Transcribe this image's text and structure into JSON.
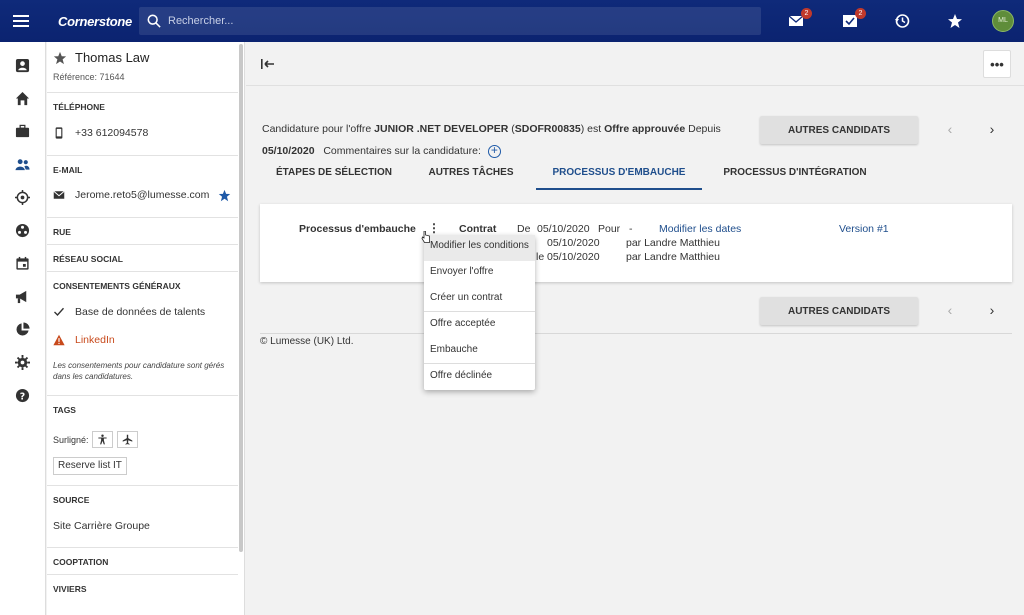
{
  "topbar": {
    "logo": "Cornerstone",
    "search_placeholder": "Rechercher...",
    "mail_badge": "2",
    "tasks_badge": "2",
    "avatar_initials": "ML"
  },
  "candidate": {
    "name": "Thomas Law",
    "reference": "Référence: 71644",
    "phone_title": "TÉLÉPHONE",
    "phone": "+33 612094578",
    "email_title": "E-MAIL",
    "email": "Jerome.reto5@lumesse.com",
    "street_title": "RUE",
    "social_title": "RÉSEAU SOCIAL",
    "consents_title": "CONSENTEMENTS GÉNÉRAUX",
    "consent_talent_db": "Base de données de talents",
    "consent_linkedin": "LinkedIn",
    "consents_note": "Les consentements pour candidature sont gérés dans les candidatures.",
    "tags_title": "TAGS",
    "highlight_label": "Surligné:",
    "tag_reserve": "Reserve list IT",
    "source_title": "SOURCE",
    "source_value": "Site Carrière Groupe",
    "cooptation_title": "COOPTATION",
    "viviers_title": "VIVIERS"
  },
  "application": {
    "prefix": "Candidature pour l'offre",
    "offer_title": "JUNIOR .NET DEVELOPER",
    "offer_ref": "SDOFR00835",
    "middle": "est",
    "status": "Offre approuvée",
    "since": "Depuis",
    "date": "05/10/2020",
    "comments_label": "Commentaires sur la candidature:"
  },
  "buttons": {
    "other_candidates": "AUTRES CANDIDATS",
    "more": "•••",
    "prev": "‹",
    "next": "›"
  },
  "tabs": [
    "ÉTAPES DE SÉLECTION",
    "AUTRES TÂCHES",
    "PROCESSUS D'EMBAUCHE",
    "PROCESSUS D'INTÉGRATION"
  ],
  "hiring": {
    "label": "Processus d'embauche",
    "contract": "Contrat",
    "from": "De",
    "from_date": "05/10/2020",
    "for": "Pour",
    "dash": "-",
    "modify_dates": "Modifier les dates",
    "version": "Version #1",
    "row2_date": "05/10/2020",
    "row2_by": "par Landre Matthieu",
    "row3_prefix": "le",
    "row3_date": "05/10/2020",
    "row3_by": "par Landre Matthieu"
  },
  "menu": [
    "Modifier les conditions",
    "Envoyer l'offre",
    "Créer un contrat",
    "Offre acceptée",
    "Embauche",
    "Offre déclinée"
  ],
  "footer": "© Lumesse (UK) Ltd."
}
